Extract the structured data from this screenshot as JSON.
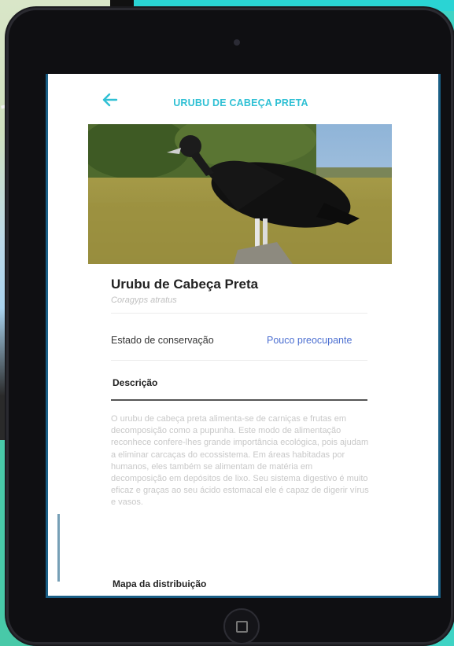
{
  "app": {
    "title": "URUBU DE CABEÇA PRETA",
    "back_icon": "arrow-left-icon"
  },
  "species": {
    "common_name": "Urubu de Cabeça Preta",
    "scientific_name": "Coragyps atratus"
  },
  "conservation": {
    "label": "Estado de conservação",
    "value": "Pouco preocupante"
  },
  "description": {
    "title": "Descrição",
    "text": "O urubu de cabeça preta alimenta-se de carniças e frutas em decomposição como a pupunha. Este modo de alimentação reconhece confere-lhes grande importância ecológica, pois ajudam a eliminar carcaças do ecossistema. Em áreas habitadas por humanos, eles também se alimentam de matéria em decomposição em depósitos de lixo. Seu sistema digestivo é muito eficaz e graças ao seu ácido estomacal ele é capaz de digerir vírus e vasos."
  },
  "map_section": {
    "title": "Mapa da distribuição"
  },
  "colors": {
    "accent": "#2fc0d4",
    "status": "#4c6fd1",
    "background": "#3fd3c4"
  }
}
